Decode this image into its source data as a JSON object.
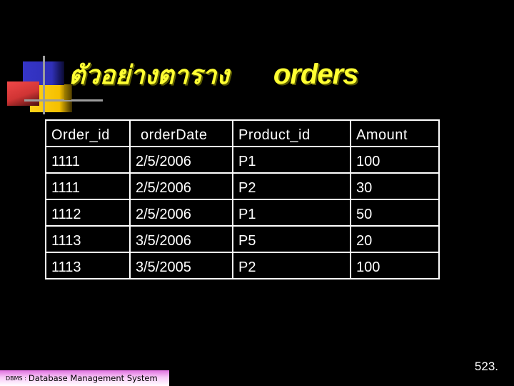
{
  "slide": {
    "title_thai": "ตัวอย่างตาราง",
    "title_table": "orders",
    "title_color": "#ffff33",
    "background": "#000000"
  },
  "table": {
    "headers": [
      "Order_id",
      "orderDate",
      "Product_id",
      "Amount"
    ],
    "rows": [
      [
        "1111",
        "2/5/2006",
        "P1",
        "100"
      ],
      [
        "1111",
        "2/5/2006",
        "P2",
        "30"
      ],
      [
        "1112",
        "2/5/2006",
        "P1",
        "50"
      ],
      [
        "1113",
        "3/5/2006",
        "P5",
        "20"
      ],
      [
        "1113",
        "3/5/2005",
        "P2",
        "100"
      ]
    ]
  },
  "footer": {
    "abbr": "DBMS :",
    "label": "Database Management System",
    "page_number": "523."
  },
  "decoration": {
    "logo_colors": {
      "blue": "#3535c8",
      "yellow": "#ffd21a",
      "red": "#f04848",
      "lines": "#9c9c9c"
    }
  }
}
